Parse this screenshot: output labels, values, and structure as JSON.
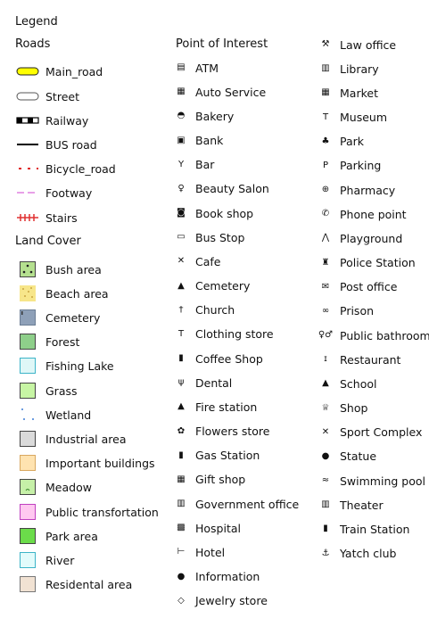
{
  "title": "Legend",
  "roads": {
    "header": "Roads",
    "items": [
      {
        "label": "Main_road",
        "icon": "main-road-symbol",
        "color": "#ffff00"
      },
      {
        "label": "Street",
        "icon": "street-symbol",
        "color": "#ffffff"
      },
      {
        "label": "Railway",
        "icon": "railway-symbol",
        "color": "#000000"
      },
      {
        "label": "BUS road",
        "icon": "bus-road-symbol",
        "color": "#000000"
      },
      {
        "label": "Bicycle_road",
        "icon": "bicycle-road-symbol",
        "color": "#e02020"
      },
      {
        "label": "Footway",
        "icon": "footway-symbol",
        "color": "#e080e0"
      },
      {
        "label": "Stairs",
        "icon": "stairs-symbol",
        "color": "#e03030"
      }
    ]
  },
  "land_cover": {
    "header": "Land Cover",
    "items": [
      {
        "label": "Bush area",
        "icon": "bush-swatch",
        "color": "#b5e08f"
      },
      {
        "label": "Beach area",
        "icon": "beach-swatch",
        "color": "#f7e68a"
      },
      {
        "label": "Cemetery",
        "icon": "cemetery-swatch",
        "color": "#8ea0b8"
      },
      {
        "label": "Forest",
        "icon": "forest-swatch",
        "color": "#8ecf8a"
      },
      {
        "label": "Fishing Lake",
        "icon": "fishing-lake-swatch",
        "color": "#dff7f7"
      },
      {
        "label": "Grass",
        "icon": "grass-swatch",
        "color": "#c7f5a4"
      },
      {
        "label": "Wetland",
        "icon": "wetland-swatch",
        "color": "#ffffff"
      },
      {
        "label": "Industrial area",
        "icon": "industrial-swatch",
        "color": "#dadada"
      },
      {
        "label": "Important buildings",
        "icon": "important-buildings-swatch",
        "color": "#ffe3b0"
      },
      {
        "label": "Meadow",
        "icon": "meadow-swatch",
        "color": "#c6f0a8"
      },
      {
        "label": "Public transfortation",
        "icon": "public-transport-swatch",
        "color": "#ffc8f0"
      },
      {
        "label": "Park area",
        "icon": "park-area-swatch",
        "color": "#6bdc4a"
      },
      {
        "label": "River",
        "icon": "river-swatch",
        "color": "#e2fbfb"
      },
      {
        "label": "Residental area",
        "icon": "residential-swatch",
        "color": "#f1e2d3"
      }
    ]
  },
  "poi": {
    "header": "Point of Interest",
    "col2": [
      {
        "label": "ATM",
        "icon": "atm-icon",
        "glyph": "▤"
      },
      {
        "label": "Auto Service",
        "icon": "auto-service-icon",
        "glyph": "▦"
      },
      {
        "label": "Bakery",
        "icon": "bakery-icon",
        "glyph": "◓"
      },
      {
        "label": "Bank",
        "icon": "bank-icon",
        "glyph": "▣"
      },
      {
        "label": "Bar",
        "icon": "bar-icon",
        "glyph": "Y"
      },
      {
        "label": "Beauty Salon",
        "icon": "beauty-salon-icon",
        "glyph": "♀"
      },
      {
        "label": "Book shop",
        "icon": "book-shop-icon",
        "glyph": "◙"
      },
      {
        "label": "Bus Stop",
        "icon": "bus-stop-icon",
        "glyph": "▭"
      },
      {
        "label": "Cafe",
        "icon": "cafe-icon",
        "glyph": "✕"
      },
      {
        "label": "Cemetery",
        "icon": "cemetery-icon",
        "glyph": "▲"
      },
      {
        "label": "Church",
        "icon": "church-icon",
        "glyph": "†"
      },
      {
        "label": "Clothing store",
        "icon": "clothing-store-icon",
        "glyph": "T"
      },
      {
        "label": "Coffee Shop",
        "icon": "coffee-shop-icon",
        "glyph": "▮"
      },
      {
        "label": "Dental",
        "icon": "dental-icon",
        "glyph": "ψ"
      },
      {
        "label": "Fire station",
        "icon": "fire-station-icon",
        "glyph": "▲"
      },
      {
        "label": "Flowers store",
        "icon": "flowers-store-icon",
        "glyph": "✿"
      },
      {
        "label": "Gas Station",
        "icon": "gas-station-icon",
        "glyph": "▮"
      },
      {
        "label": "Gift shop",
        "icon": "gift-shop-icon",
        "glyph": "▦"
      },
      {
        "label": "Government office",
        "icon": "government-office-icon",
        "glyph": "▥"
      },
      {
        "label": "Hospital",
        "icon": "hospital-icon",
        "glyph": "▩"
      },
      {
        "label": "Hotel",
        "icon": "hotel-icon",
        "glyph": "⊢"
      },
      {
        "label": "Information",
        "icon": "information-icon",
        "glyph": "●"
      },
      {
        "label": "Jewelry store",
        "icon": "jewelry-store-icon",
        "glyph": "◇"
      }
    ],
    "col3": [
      {
        "label": "Law office",
        "icon": "law-office-icon",
        "glyph": "⚒"
      },
      {
        "label": "Library",
        "icon": "library-icon",
        "glyph": "▥"
      },
      {
        "label": "Market",
        "icon": "market-icon",
        "glyph": "▦"
      },
      {
        "label": "Museum",
        "icon": "museum-icon",
        "glyph": "T"
      },
      {
        "label": "Park",
        "icon": "park-icon",
        "glyph": "♣"
      },
      {
        "label": "Parking",
        "icon": "parking-icon",
        "glyph": "P"
      },
      {
        "label": "Pharmacy",
        "icon": "pharmacy-icon",
        "glyph": "⊕"
      },
      {
        "label": "Phone point",
        "icon": "phone-point-icon",
        "glyph": "✆"
      },
      {
        "label": "Playground",
        "icon": "playground-icon",
        "glyph": "⋀"
      },
      {
        "label": "Police Station",
        "icon": "police-station-icon",
        "glyph": "♜"
      },
      {
        "label": "Post office",
        "icon": "post-office-icon",
        "glyph": "✉"
      },
      {
        "label": "Prison",
        "icon": "prison-icon",
        "glyph": "∞"
      },
      {
        "label": "Public bathroom",
        "icon": "public-bathroom-icon",
        "glyph": "♀♂"
      },
      {
        "label": "Restaurant",
        "icon": "restaurant-icon",
        "glyph": "ɪ"
      },
      {
        "label": "School",
        "icon": "school-icon",
        "glyph": "▲"
      },
      {
        "label": "Shop",
        "icon": "shop-icon",
        "glyph": "♕"
      },
      {
        "label": "Sport Complex",
        "icon": "sport-complex-icon",
        "glyph": "✕"
      },
      {
        "label": "Statue",
        "icon": "statue-icon",
        "glyph": "●"
      },
      {
        "label": "Swimming pool",
        "icon": "swimming-pool-icon",
        "glyph": "≈"
      },
      {
        "label": "Theater",
        "icon": "theater-icon",
        "glyph": "▥"
      },
      {
        "label": "Train Station",
        "icon": "train-station-icon",
        "glyph": "▮"
      },
      {
        "label": "Yatch club",
        "icon": "yacht-club-icon",
        "glyph": "⚓"
      }
    ]
  }
}
